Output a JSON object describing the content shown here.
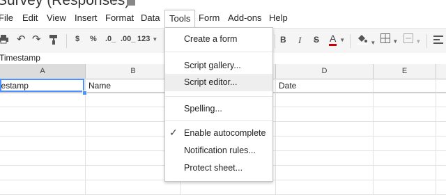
{
  "window": {
    "title": "Survey (Responses)"
  },
  "menubar": {
    "items": [
      "File",
      "Edit",
      "View",
      "Insert",
      "Format",
      "Data",
      "Tools",
      "Form",
      "Add-ons",
      "Help"
    ]
  },
  "toolbar": {
    "currency": "$",
    "percent": "%",
    "decrease_decimals": ".0_",
    "increase_decimals": ".00_",
    "more_formats": "123",
    "bold": "B",
    "italic": "I",
    "strikethrough": "S",
    "text_color": "A"
  },
  "formula_bar": {
    "value": "Timestamp"
  },
  "grid": {
    "columns": [
      "A",
      "B",
      "C",
      "D",
      "E"
    ],
    "row1": [
      "Timestamp",
      "Name",
      "",
      "Date",
      ""
    ]
  },
  "tools_menu": {
    "items": [
      {
        "label": "Create a form"
      },
      {
        "label": "Script gallery..."
      },
      {
        "label": "Script editor..."
      },
      {
        "label": "Spelling..."
      },
      {
        "label": "Enable autocomplete",
        "checked": true
      },
      {
        "label": "Notification rules..."
      },
      {
        "label": "Protect sheet..."
      }
    ],
    "highlighted": "Script editor..."
  },
  "colors": {
    "accent": "#4d90fe",
    "highlight": "#eeeeee",
    "text_color_underline": "#cc0000"
  }
}
